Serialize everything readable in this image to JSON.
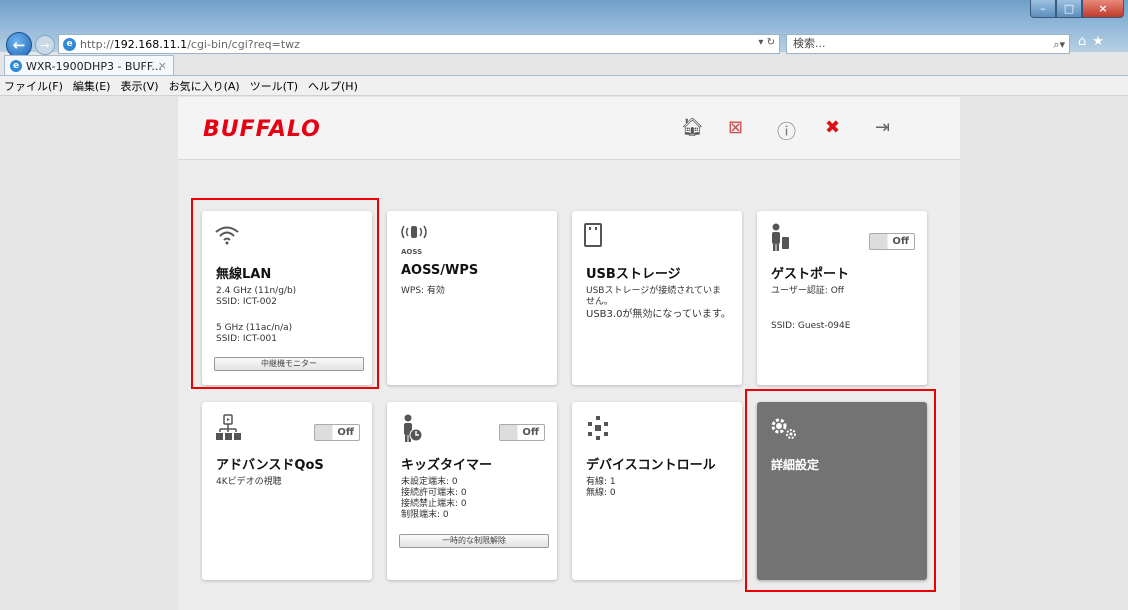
{
  "browser": {
    "url_prefix": "http://",
    "url_host": "192.168.11.1",
    "url_path": "/cgi-bin/cgi?req=twz",
    "search_placeholder": "検索...",
    "tab_title": "WXR-1900DHP3 - BUFF...",
    "menu": [
      "ファイル(F)",
      "編集(E)",
      "表示(V)",
      "お気に入り(A)",
      "ツール(T)",
      "ヘルプ(H)"
    ]
  },
  "header": {
    "logo": "BUFFALO"
  },
  "cards": {
    "wireless": {
      "title": "無線LAN",
      "info1": "2.4 GHz (11n/g/b)\nSSID: ICT-002",
      "info2": "5 GHz (11ac/n/a)\nSSID: ICT-001",
      "button": "中継機モニター"
    },
    "aoss": {
      "icon_label": "AOSS",
      "title": "AOSS/WPS",
      "info": "WPS: 有効"
    },
    "usb": {
      "title": "USBストレージ",
      "info": "USBストレージが接続されていま\nせん。",
      "info_b": "USB3.0が無効になっています。"
    },
    "guest": {
      "title": "ゲストポート",
      "toggle": "Off",
      "info1": "ユーザー認証: Off",
      "info2": "SSID: Guest-094E"
    },
    "qos": {
      "title": "アドバンスドQoS",
      "toggle": "Off",
      "info": "4Kビデオの視聴"
    },
    "kids": {
      "title": "キッズタイマー",
      "toggle": "Off",
      "info": "未設定端末: 0\n接続許可端末: 0\n接続禁止端末: 0\n制限端末: 0",
      "button": "一時的な制限解除"
    },
    "device": {
      "title": "デバイスコントロール",
      "info": "有線: 1\n無線: 0"
    },
    "advanced": {
      "title": "詳細設定"
    }
  },
  "colors": {
    "brand": "#e60012",
    "highlight": "#e00000",
    "dark_card": "#737373"
  }
}
